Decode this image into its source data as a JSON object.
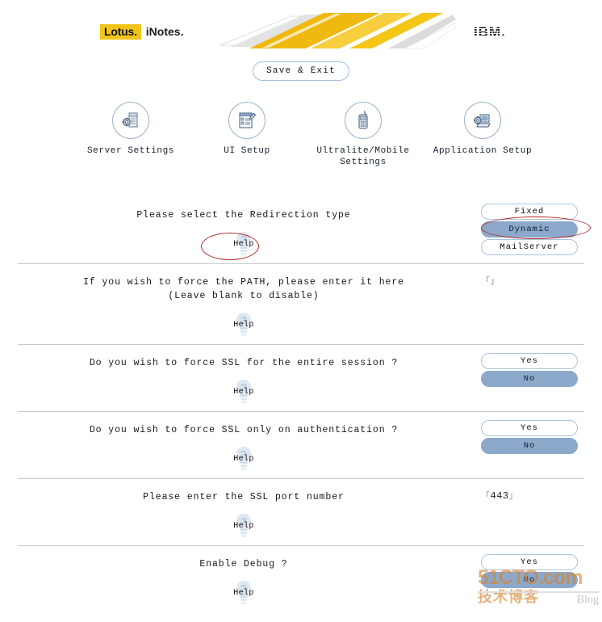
{
  "header": {
    "lotus_mark": "Lotus.",
    "inotes_mark": "iNotes.",
    "ibm_mark": "IBM.",
    "banner_colors": [
      "#f5c518",
      "#f7d048",
      "#e8e8e8",
      "#c9c9c9"
    ]
  },
  "toolbar": {
    "save_exit_label": "Save & Exit",
    "items": [
      {
        "label": "Server Settings",
        "icon": "server-settings-icon"
      },
      {
        "label": "UI Setup",
        "icon": "ui-setup-icon"
      },
      {
        "label": "Ultralite/Mobile Settings",
        "icon": "mobile-settings-icon"
      },
      {
        "label": "Application Setup",
        "icon": "application-setup-icon"
      }
    ]
  },
  "help_label": "Help",
  "field_bracket_open": "「",
  "field_bracket_close": "」",
  "rows": [
    {
      "question": "Please select the Redirection type",
      "control": "options",
      "options": [
        "Fixed",
        "Dynamic",
        "MailServer"
      ],
      "selected": "Dynamic",
      "annotated_help": true,
      "annotated_option": "Dynamic"
    },
    {
      "question_line1": "If you wish to force the PATH, please enter it here",
      "question_line2": "(Leave blank to disable)",
      "control": "text",
      "value": "",
      "annotated_help": false
    },
    {
      "question": "Do you wish to force SSL for the entire session ?",
      "control": "options",
      "options": [
        "Yes",
        "No"
      ],
      "selected": "No",
      "annotated_help": false
    },
    {
      "question": "Do you wish to force SSL only on authentication ?",
      "control": "options",
      "options": [
        "Yes",
        "No"
      ],
      "selected": "No",
      "annotated_help": false
    },
    {
      "question": "Please enter the SSL port number",
      "control": "text",
      "value": "443",
      "annotated_help": false
    },
    {
      "question": "Enable Debug ?",
      "control": "options",
      "options": [
        "Yes",
        "No"
      ],
      "selected": "No",
      "annotated_help": false
    }
  ],
  "watermark": {
    "main": "51CTO.com",
    "chinese": "技术博客",
    "blog": "Blog",
    "color": "#d9822b"
  },
  "colors": {
    "selected_button": "#8ca9cc",
    "button_border": "#a9c4de",
    "annotation": "#b32b2b",
    "divider": "#c9c9c9",
    "lotus_yellow": "#f2c41a"
  }
}
